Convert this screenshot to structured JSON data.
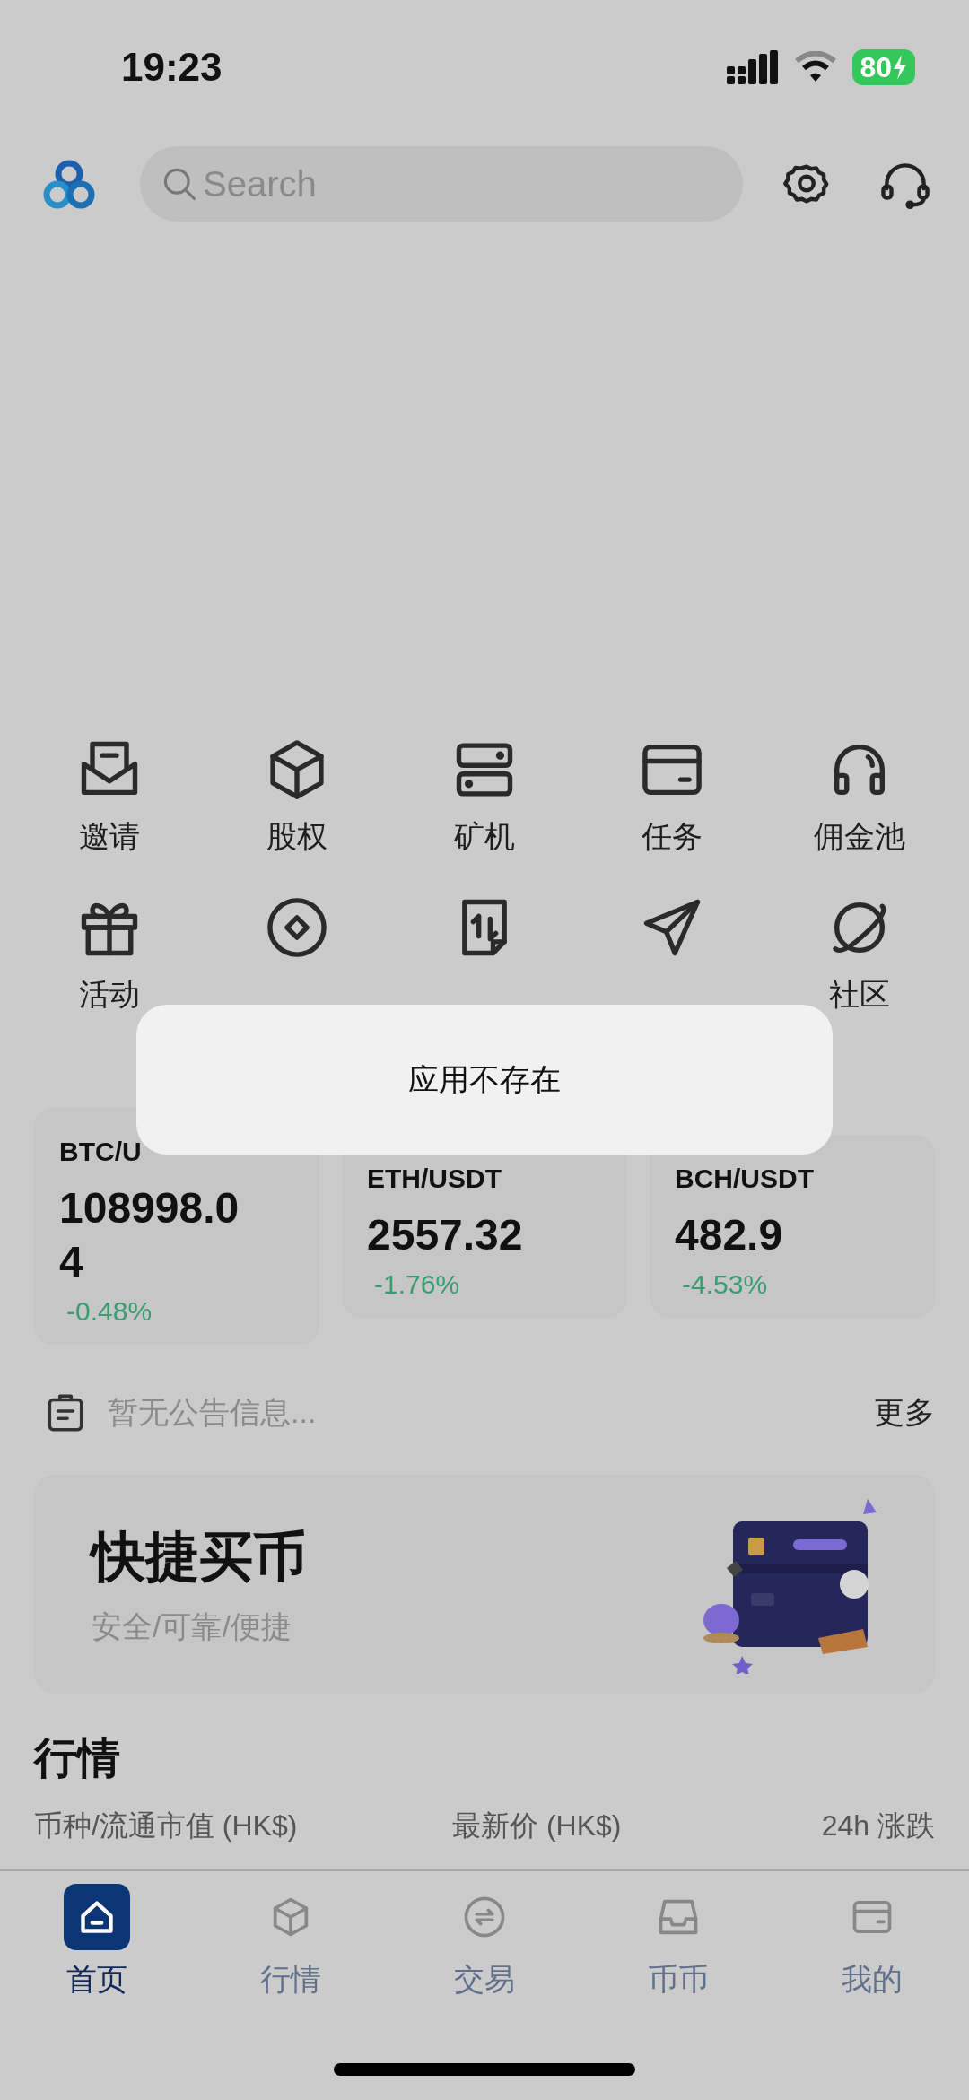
{
  "status_bar": {
    "time": "19:23",
    "battery": "80"
  },
  "header": {
    "search": {
      "placeholder": "Search"
    }
  },
  "shortcuts": [
    {
      "label": "邀请",
      "covered": false
    },
    {
      "label": "股权",
      "covered": false
    },
    {
      "label": "矿机",
      "covered": false
    },
    {
      "label": "任务",
      "covered": false
    },
    {
      "label": "佣金池",
      "covered": false
    },
    {
      "label": "活动",
      "covered": false
    },
    {
      "covered": true
    },
    {
      "covered": true
    },
    {
      "covered": true
    },
    {
      "label": "社区",
      "covered": false
    }
  ],
  "tickers": [
    {
      "pair": "BTC/U",
      "price": "108998.04",
      "change": "-0.48%"
    },
    {
      "pair": "ETH/USDT",
      "price": "2557.32",
      "change": "-1.76%"
    },
    {
      "pair": "BCH/USDT",
      "price": "482.9",
      "change": "-4.53%"
    }
  ],
  "notice": {
    "text": "暂无公告信息...",
    "more": "更多"
  },
  "banner": {
    "title": "快捷买币",
    "subtitle": "安全/可靠/便捷"
  },
  "market": {
    "title": "行情",
    "columns": [
      "币种/流通市值 (HK$)",
      "最新价 (HK$)",
      "24h 涨跌"
    ]
  },
  "tab_bar": [
    {
      "label": "首页",
      "selected": true
    },
    {
      "label": "行情",
      "selected": false
    },
    {
      "label": "交易",
      "selected": false
    },
    {
      "label": "币币",
      "selected": false
    },
    {
      "label": "我的",
      "selected": false
    }
  ],
  "toast": {
    "text": "应用不存在"
  }
}
